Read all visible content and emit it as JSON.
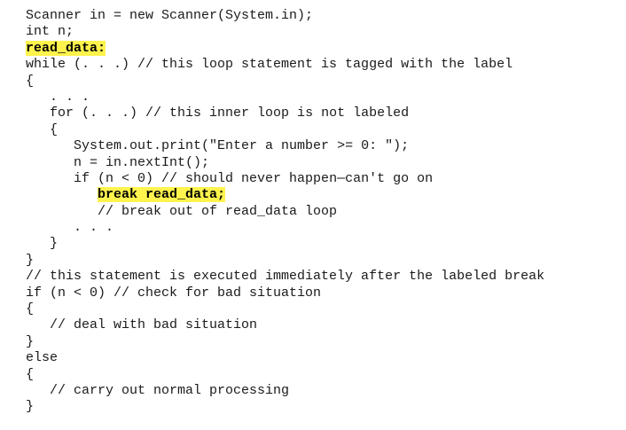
{
  "code": {
    "lines": [
      {
        "indent": "",
        "pre": "Scanner in = new Scanner(System.in);",
        "hl": "",
        "post": ""
      },
      {
        "indent": "",
        "pre": "int n;",
        "hl": "",
        "post": ""
      },
      {
        "indent": "",
        "pre": "",
        "hl": "read_data:",
        "post": ""
      },
      {
        "indent": "",
        "pre": "while (. . .) // this loop statement is tagged with the label",
        "hl": "",
        "post": ""
      },
      {
        "indent": "",
        "pre": "{",
        "hl": "",
        "post": ""
      },
      {
        "indent": "   ",
        "pre": ". . .",
        "hl": "",
        "post": ""
      },
      {
        "indent": "   ",
        "pre": "for (. . .) // this inner loop is not labeled",
        "hl": "",
        "post": ""
      },
      {
        "indent": "   ",
        "pre": "{",
        "hl": "",
        "post": ""
      },
      {
        "indent": "      ",
        "pre": "System.out.print(\"Enter a number >= 0: \");",
        "hl": "",
        "post": ""
      },
      {
        "indent": "      ",
        "pre": "n = in.nextInt();",
        "hl": "",
        "post": ""
      },
      {
        "indent": "      ",
        "pre": "if (n < 0) // should never happen—can't go on",
        "hl": "",
        "post": ""
      },
      {
        "indent": "         ",
        "pre": "",
        "hl": "break read_data;",
        "post": ""
      },
      {
        "indent": "         ",
        "pre": "// break out of read_data loop",
        "hl": "",
        "post": ""
      },
      {
        "indent": "      ",
        "pre": ". . .",
        "hl": "",
        "post": ""
      },
      {
        "indent": "   ",
        "pre": "}",
        "hl": "",
        "post": ""
      },
      {
        "indent": "",
        "pre": "}",
        "hl": "",
        "post": ""
      },
      {
        "indent": "",
        "pre": "// this statement is executed immediately after the labeled break",
        "hl": "",
        "post": ""
      },
      {
        "indent": "",
        "pre": "if (n < 0) // check for bad situation",
        "hl": "",
        "post": ""
      },
      {
        "indent": "",
        "pre": "{",
        "hl": "",
        "post": ""
      },
      {
        "indent": "   ",
        "pre": "// deal with bad situation",
        "hl": "",
        "post": ""
      },
      {
        "indent": "",
        "pre": "}",
        "hl": "",
        "post": ""
      },
      {
        "indent": "",
        "pre": "else",
        "hl": "",
        "post": ""
      },
      {
        "indent": "",
        "pre": "{",
        "hl": "",
        "post": ""
      },
      {
        "indent": "   ",
        "pre": "// carry out normal processing",
        "hl": "",
        "post": ""
      },
      {
        "indent": "",
        "pre": "}",
        "hl": "",
        "post": ""
      }
    ]
  }
}
